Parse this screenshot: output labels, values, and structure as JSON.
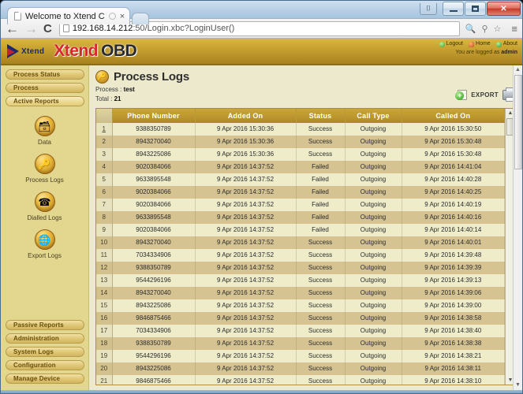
{
  "browser": {
    "tab": {
      "title": "Welcome to Xtend C",
      "favicon": "page-icon",
      "spinner": "loading-spinner",
      "close": "×"
    },
    "newtab_label": "",
    "nav": {
      "back": "←",
      "forward": "→",
      "reload": "C"
    },
    "url_host": "192.168.14.212",
    "url_rest": ":50/Login.xbc?LoginUser()",
    "omnibox_icons": {
      "zoom": "search-icon",
      "key": "key-icon",
      "star": "☆"
    },
    "menu": "≡",
    "window_controls": {
      "pin": "pin-icon",
      "minimize": "minimize-icon",
      "maximize": "maximize-icon",
      "close": "✕"
    }
  },
  "header": {
    "logo_small": "Xtend",
    "logo_main": "Xtend",
    "logo_suffix": "OBD",
    "links": [
      {
        "label": "Logout",
        "icon": "logout-icon"
      },
      {
        "label": "Home",
        "icon": "home-icon"
      },
      {
        "label": "About",
        "icon": "about-icon"
      }
    ],
    "logged_prefix": "You are logged as ",
    "logged_user": "admin"
  },
  "sidebar": {
    "top_buttons": [
      {
        "label": "Process Status",
        "active": false
      },
      {
        "label": "Process",
        "active": false
      },
      {
        "label": "Active Reports",
        "active": true
      }
    ],
    "icons": [
      {
        "label": "Data",
        "icon": "database-icon",
        "glyph": "🗄"
      },
      {
        "label": "Process Logs",
        "icon": "process-logs-icon",
        "glyph": "🔑"
      },
      {
        "label": "Dialled Logs",
        "icon": "dialled-logs-icon",
        "glyph": "📞"
      },
      {
        "label": "Export Logs",
        "icon": "export-logs-icon",
        "glyph": "🌐"
      }
    ],
    "bottom_buttons": [
      {
        "label": "Passive Reports"
      },
      {
        "label": "Administration"
      },
      {
        "label": "System Logs"
      },
      {
        "label": "Configuration"
      },
      {
        "label": "Manage Device"
      }
    ]
  },
  "main": {
    "title": "Process Logs",
    "title_icon": "process-logs-icon",
    "process_label": "Process : ",
    "process_value": "test",
    "total_label": "Total : ",
    "total_value": "21",
    "export_label": "EXPORT",
    "print_icon": "printer-icon",
    "columns": [
      "",
      "Phone Number",
      "Added On",
      "Status",
      "Call Type",
      "Called On"
    ],
    "rows": [
      {
        "idx": "1",
        "phone": "9388350789",
        "added": "9 Apr 2016 15:30:36",
        "status": "Success",
        "type": "Outgoing",
        "called": "9 Apr 2016 15:30:50"
      },
      {
        "idx": "2",
        "phone": "8943270040",
        "added": "9 Apr 2016 15:30:36",
        "status": "Success",
        "type": "Outgoing",
        "called": "9 Apr 2016 15:30:48"
      },
      {
        "idx": "3",
        "phone": "8943225086",
        "added": "9 Apr 2016 15:30:36",
        "status": "Success",
        "type": "Outgoing",
        "called": "9 Apr 2016 15:30:48"
      },
      {
        "idx": "4",
        "phone": "9020384066",
        "added": "9 Apr 2016 14:37:52",
        "status": "Failed",
        "type": "Outgoing",
        "called": "9 Apr 2016 14:41:04"
      },
      {
        "idx": "5",
        "phone": "9633895548",
        "added": "9 Apr 2016 14:37:52",
        "status": "Failed",
        "type": "Outgoing",
        "called": "9 Apr 2016 14:40:28"
      },
      {
        "idx": "6",
        "phone": "9020384066",
        "added": "9 Apr 2016 14:37:52",
        "status": "Failed",
        "type": "Outgoing",
        "called": "9 Apr 2016 14:40:25"
      },
      {
        "idx": "7",
        "phone": "9020384066",
        "added": "9 Apr 2016 14:37:52",
        "status": "Failed",
        "type": "Outgoing",
        "called": "9 Apr 2016 14:40:19"
      },
      {
        "idx": "8",
        "phone": "9633895548",
        "added": "9 Apr 2016 14:37:52",
        "status": "Failed",
        "type": "Outgoing",
        "called": "9 Apr 2016 14:40:16"
      },
      {
        "idx": "9",
        "phone": "9020384066",
        "added": "9 Apr 2016 14:37:52",
        "status": "Failed",
        "type": "Outgoing",
        "called": "9 Apr 2016 14:40:14"
      },
      {
        "idx": "10",
        "phone": "8943270040",
        "added": "9 Apr 2016 14:37:52",
        "status": "Success",
        "type": "Outgoing",
        "called": "9 Apr 2016 14:40:01"
      },
      {
        "idx": "11",
        "phone": "7034334906",
        "added": "9 Apr 2016 14:37:52",
        "status": "Success",
        "type": "Outgoing",
        "called": "9 Apr 2016 14:39:48"
      },
      {
        "idx": "12",
        "phone": "9388350789",
        "added": "9 Apr 2016 14:37:52",
        "status": "Success",
        "type": "Outgoing",
        "called": "9 Apr 2016 14:39:39"
      },
      {
        "idx": "13",
        "phone": "9544296196",
        "added": "9 Apr 2016 14:37:52",
        "status": "Success",
        "type": "Outgoing",
        "called": "9 Apr 2016 14:39:13"
      },
      {
        "idx": "14",
        "phone": "8943270040",
        "added": "9 Apr 2016 14:37:52",
        "status": "Success",
        "type": "Outgoing",
        "called": "9 Apr 2016 14:39:06"
      },
      {
        "idx": "15",
        "phone": "8943225086",
        "added": "9 Apr 2016 14:37:52",
        "status": "Success",
        "type": "Outgoing",
        "called": "9 Apr 2016 14:39:00"
      },
      {
        "idx": "16",
        "phone": "9846875466",
        "added": "9 Apr 2016 14:37:52",
        "status": "Success",
        "type": "Outgoing",
        "called": "9 Apr 2016 14:38:58"
      },
      {
        "idx": "17",
        "phone": "7034334906",
        "added": "9 Apr 2016 14:37:52",
        "status": "Success",
        "type": "Outgoing",
        "called": "9 Apr 2016 14:38:40"
      },
      {
        "idx": "18",
        "phone": "9388350789",
        "added": "9 Apr 2016 14:37:52",
        "status": "Success",
        "type": "Outgoing",
        "called": "9 Apr 2016 14:38:38"
      },
      {
        "idx": "19",
        "phone": "9544296196",
        "added": "9 Apr 2016 14:37:52",
        "status": "Success",
        "type": "Outgoing",
        "called": "9 Apr 2016 14:38:21"
      },
      {
        "idx": "20",
        "phone": "8943225086",
        "added": "9 Apr 2016 14:37:52",
        "status": "Success",
        "type": "Outgoing",
        "called": "9 Apr 2016 14:38:11"
      },
      {
        "idx": "21",
        "phone": "9846875466",
        "added": "9 Apr 2016 14:37:52",
        "status": "Success",
        "type": "Outgoing",
        "called": "9 Apr 2016 14:38:10"
      }
    ],
    "scroll_up": "▲",
    "scroll_down": "▼"
  },
  "colors": {
    "brand_gold": "#c9a431",
    "table_header": "#bd9730",
    "row_even": "#eeecc9",
    "row_odd": "#d6c392",
    "sidebar": "#e3d78f",
    "content_bg": "#ece9cd",
    "logo_red": "#d9252c"
  }
}
